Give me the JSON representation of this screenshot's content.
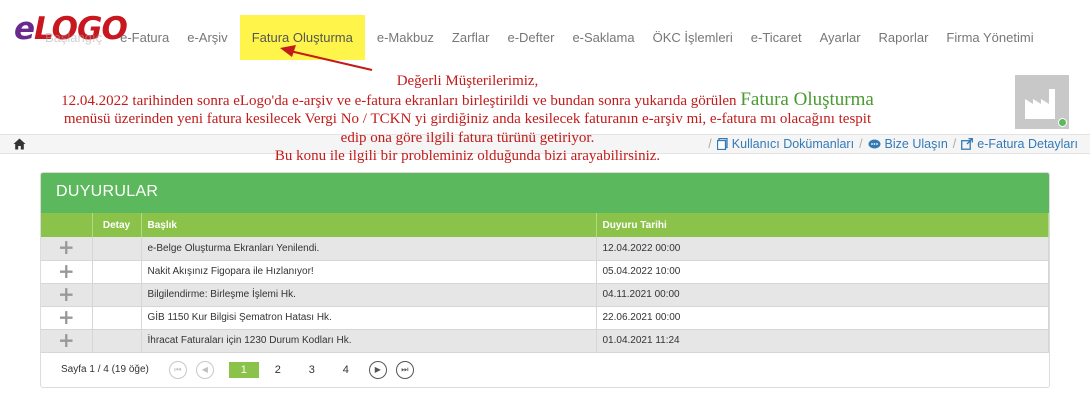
{
  "nav": {
    "logo_e": "e",
    "logo_rest": "LOGO",
    "items": [
      {
        "label": "Başlangıç"
      },
      {
        "label": "e-Fatura"
      },
      {
        "label": "e-Arşiv"
      },
      {
        "label": "Fatura Oluşturma"
      },
      {
        "label": "e-Makbuz"
      },
      {
        "label": "Zarflar"
      },
      {
        "label": "e-Defter"
      },
      {
        "label": "e-Saklama"
      },
      {
        "label": "ÖKC İşlemleri"
      },
      {
        "label": "e-Ticaret"
      },
      {
        "label": "Ayarlar"
      },
      {
        "label": "Raporlar"
      },
      {
        "label": "Firma Yönetimi"
      }
    ]
  },
  "notice": {
    "greeting": "Değerli Müşterilerimiz,",
    "line1_a": "12.04.2022 tarihinden sonra eLogo'da e-arşiv ve e-fatura ekranları birleştirildi ve bundan sonra yukarıda görülen ",
    "highlight": "Fatura Oluşturma",
    "line1_b": " menüsü üzerinden yeni fatura kesilecek Vergi No  / TCKN yi girdiğiniz anda kesilecek faturanın e-arşiv mi, e-fatura mı olacağını tespit edip ona göre ilgili fatura türünü getiriyor.",
    "line2": "Bu konu ile ilgili bir probleminiz olduğunda bizi arayabilirsiniz."
  },
  "breadcrumb": {
    "links": [
      {
        "label": "Kullanıcı Dokümanları",
        "icon": "document-icon"
      },
      {
        "label": "Bize Ulaşın",
        "icon": "chat-icon"
      },
      {
        "label": "e-Fatura Detayları",
        "icon": "external-link-icon"
      }
    ]
  },
  "panel": {
    "title": "DUYURULAR",
    "columns": {
      "detay": "Detay",
      "baslik": "Başlık",
      "tarih": "Duyuru Tarihi"
    },
    "rows": [
      {
        "title": "e-Belge Oluşturma Ekranları Yenilendi.",
        "date": "12.04.2022 00:00"
      },
      {
        "title": "Nakit Akışınız Figopara ile Hızlanıyor!",
        "date": "05.04.2022 10:00"
      },
      {
        "title": "Bilgilendirme: Birleşme İşlemi Hk.",
        "date": "04.11.2021 00:00"
      },
      {
        "title": "GİB 1150 Kur Bilgisi Şematron Hatası Hk.",
        "date": "22.06.2021 00:00"
      },
      {
        "title": "İhracat Faturaları için 1230 Durum Kodları Hk.",
        "date": "01.04.2021 11:24"
      }
    ],
    "plus_glyph": "+",
    "pager": {
      "info": "Sayfa 1 / 4 (19 öğe)",
      "pages": [
        "1",
        "2",
        "3",
        "4"
      ],
      "first": "⏮",
      "prev": "◀",
      "next": "▶",
      "last": "⏭"
    }
  },
  "colors": {
    "panel_green": "#5cb85c",
    "header_green": "#8bc34a",
    "highlight_yellow": "#fff54a",
    "notice_red": "#c41a1a",
    "link_blue": "#337ab7"
  }
}
